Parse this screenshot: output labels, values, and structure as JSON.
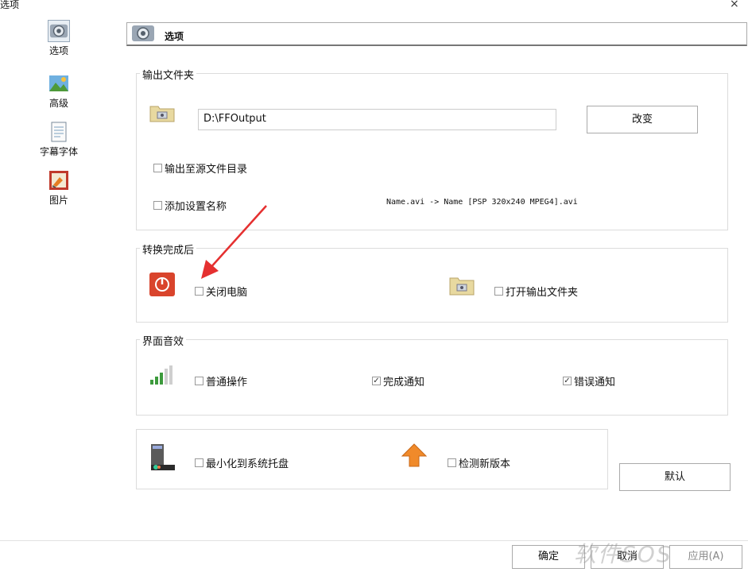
{
  "window": {
    "title": "选项",
    "close_glyph": "×"
  },
  "sidebar": {
    "items": [
      {
        "label": "选项",
        "icon": "options-camera-icon"
      },
      {
        "label": "高级",
        "icon": "landscape-picture-icon"
      },
      {
        "label": "字幕字体",
        "icon": "document-icon"
      },
      {
        "label": "图片",
        "icon": "paint-icon"
      }
    ]
  },
  "header": {
    "title": "选项"
  },
  "output_folder": {
    "group_label": "输出文件夹",
    "path_value": "D:\\FFOutput",
    "change_button": "改变",
    "output_to_source": "输出至源文件目录",
    "add_setting_name": "添加设置名称",
    "name_example": "Name.avi  -> Name [PSP 320x240 MPEG4].avi"
  },
  "after_convert": {
    "group_label": "转换完成后",
    "shutdown": "关闭电脑",
    "open_output_folder": "打开输出文件夹"
  },
  "ui_sound": {
    "group_label": "界面音效",
    "normal_operation": "普通操作",
    "complete_notice": "完成通知",
    "error_notice": "错误通知",
    "complete_checked": true,
    "error_checked": true
  },
  "misc": {
    "minimize_to_tray": "最小化到系统托盘",
    "check_new_version": "检测新版本",
    "default_button": "默认"
  },
  "footer": {
    "ok_button": "确定",
    "cancel_button": "取消",
    "apply_button": "应用(A)"
  },
  "watermark": {
    "text": "软件SOS"
  },
  "colors": {
    "accent_red": "#d9442c",
    "folder_yellow": "#e8d9a0",
    "arrow_orange": "#f08a2a"
  }
}
